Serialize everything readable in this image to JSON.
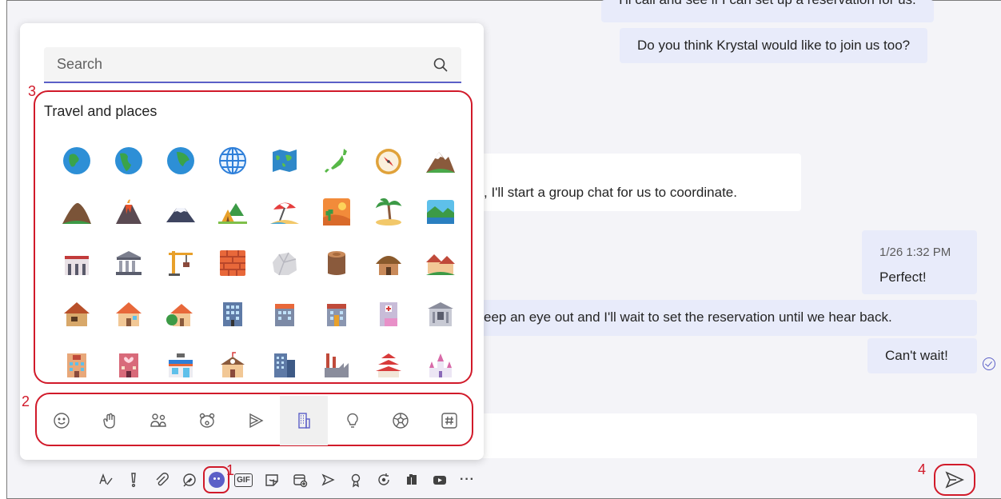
{
  "chat": {
    "msg_top_partial": "I'll call and see if I can set up a reservation for us.",
    "msg_krystal": "Do you think Krystal would like to join us too?",
    "msg_group_chat": ", I'll start a group chat for us to coordinate.",
    "perfect_time": "1/26 1:32 PM",
    "perfect_text": "Perfect!",
    "msg_keep_eye": "eep an eye out and I'll wait to set the reservation until we hear back.",
    "msg_cant_wait": "Can't wait!"
  },
  "emoji_panel": {
    "search_placeholder": "Search",
    "section_title": "Travel and places",
    "categories": [
      "smileys",
      "hands",
      "people",
      "animals",
      "food",
      "travel",
      "objects",
      "activities",
      "symbols"
    ],
    "active_category": "travel"
  },
  "markers": {
    "one": "1",
    "two": "2",
    "three": "3",
    "four": "4"
  },
  "toolbar": {
    "gif_label": "GIF",
    "more_label": "···"
  },
  "colors": {
    "accent": "#5b5fc7",
    "highlight": "#d11a2a"
  }
}
